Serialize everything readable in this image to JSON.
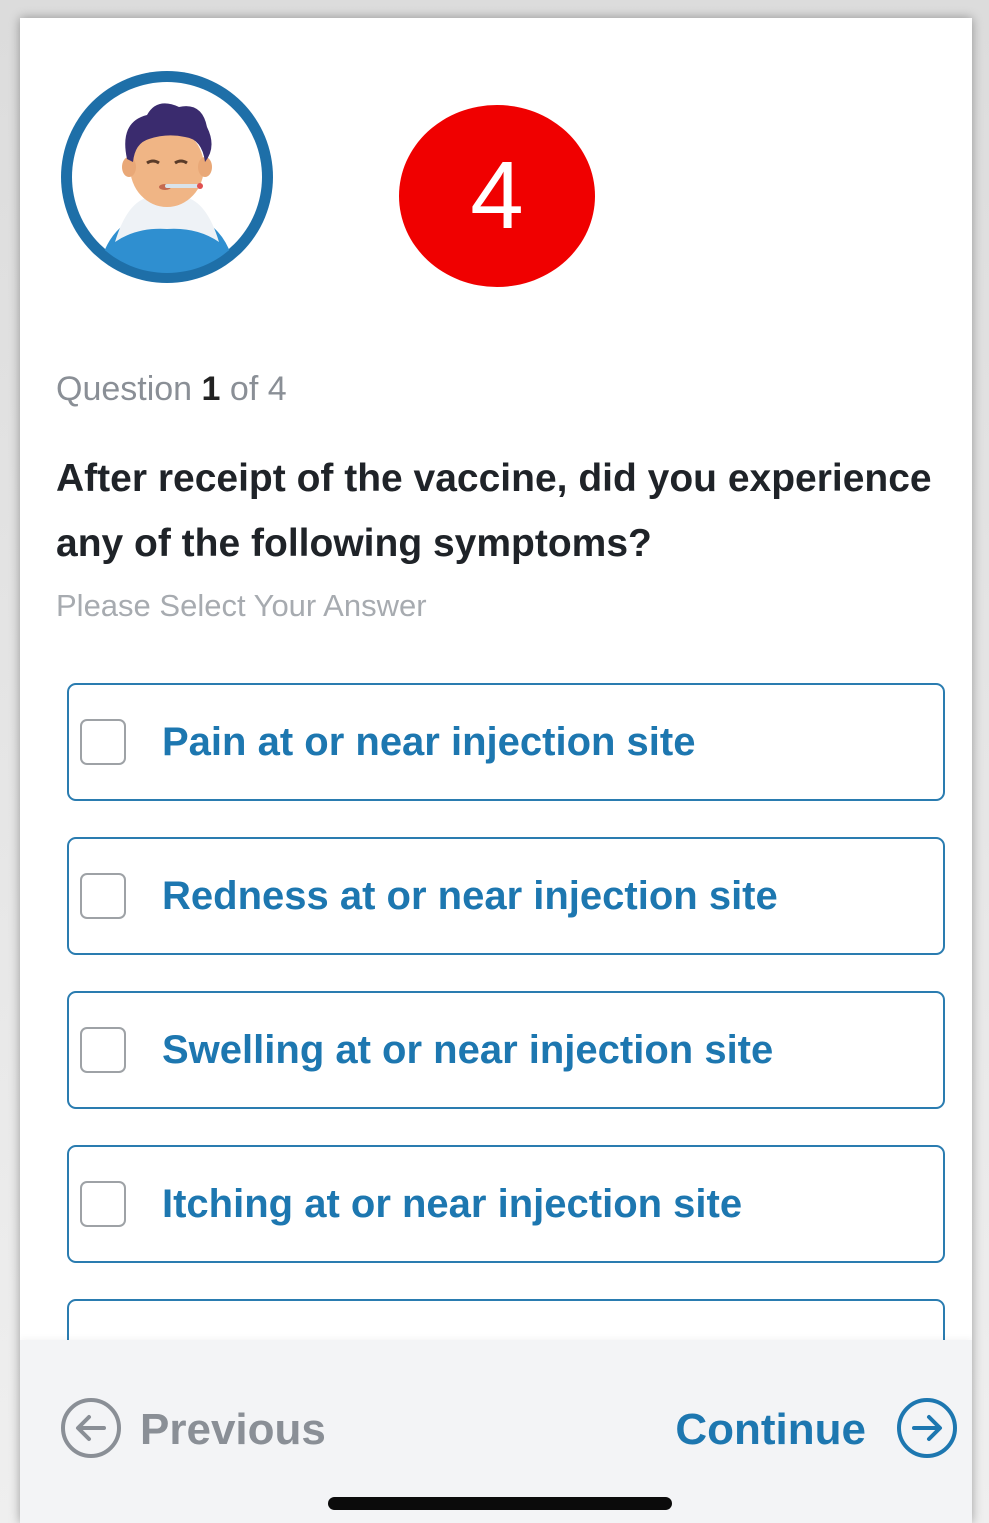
{
  "step_badge": "4",
  "question": {
    "counter_prefix": "Question",
    "current": "1",
    "counter_suffix": "of 4",
    "text": "After receipt of the vaccine, did you experience any of the following symptoms?",
    "hint": "Please Select Your Answer"
  },
  "options": [
    {
      "label": "Pain at or near injection site",
      "checked": false
    },
    {
      "label": "Redness at or near injection site",
      "checked": false
    },
    {
      "label": "Swelling at or near injection site",
      "checked": false
    },
    {
      "label": "Itching at or near injection site",
      "checked": false
    }
  ],
  "footer": {
    "previous_label": "Previous",
    "continue_label": "Continue"
  },
  "colors": {
    "primary": "#1d77b0",
    "badge": "#f00000",
    "muted": "#8a8f96"
  },
  "icons": {
    "avatar": "sick-person-thermometer-icon",
    "previous": "arrow-left-circle-icon",
    "continue": "arrow-right-circle-icon"
  }
}
